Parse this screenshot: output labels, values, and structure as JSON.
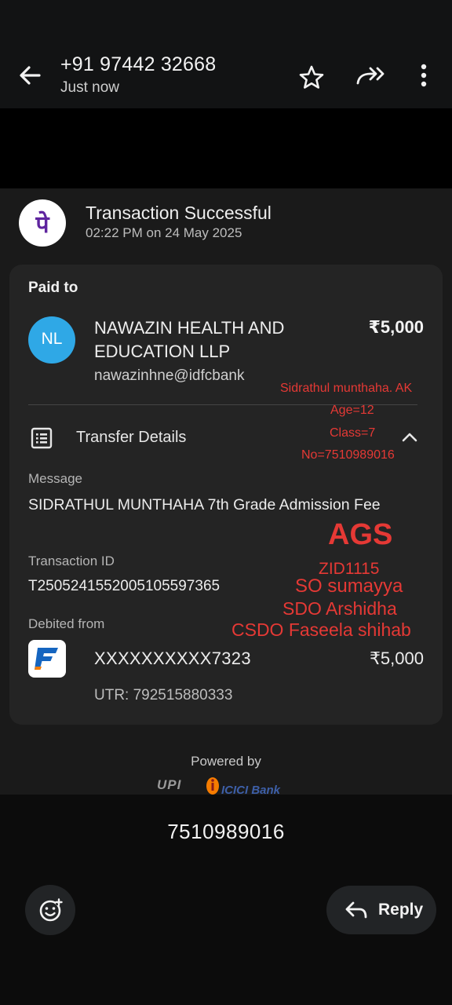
{
  "header": {
    "contact_number": "+91 97442 32668",
    "status": "Just now",
    "icons": [
      "back-arrow-icon",
      "star-icon",
      "forward-icon",
      "more-vert-icon"
    ]
  },
  "receipt": {
    "app_logo_glyph": "पे",
    "status_title": "Transaction Successful",
    "status_time": "02:22 PM on 24 May 2025",
    "paid_to_label": "Paid to",
    "payee": {
      "initials": "NL",
      "name": "NAWAZIN HEALTH AND EDUCATION LLP",
      "upi_id": "nawazinhne@idfcbank",
      "amount": "₹5,000"
    },
    "transfer_details_label": "Transfer Details",
    "message_label": "Message",
    "message_value": "SIDRATHUL MUNTHAHA 7th Grade Admission Fee",
    "transaction_id_label": "Transaction ID",
    "transaction_id": "T2505241552005105597365",
    "debited_from_label": "Debited from",
    "account_number": "XXXXXXXXXX7323",
    "account_amount": "₹5,000",
    "utr": "UTR: 792515880333",
    "powered_by": "Powered by",
    "upi_brand": "UPI",
    "bank_brand": "ICICI Bank"
  },
  "annotations": {
    "student_name": "Sidrathul munthaha. AK",
    "age": "Age=12",
    "class": "Class=7",
    "phone": "No=7510989016",
    "school": "AGS",
    "zid": "ZID1115",
    "so": "SO sumayya",
    "sdo": "SDO Arshidha",
    "csdo": "CSDO Faseela shihab"
  },
  "message_caption": "7510989016",
  "bottom_bar": {
    "reply_label": "Reply"
  },
  "colors": {
    "phonepe_purple": "#5f259f",
    "annotation_red": "#e53935",
    "payee_avatar_blue": "#2fa8e6",
    "background": "#0c0c0c"
  }
}
